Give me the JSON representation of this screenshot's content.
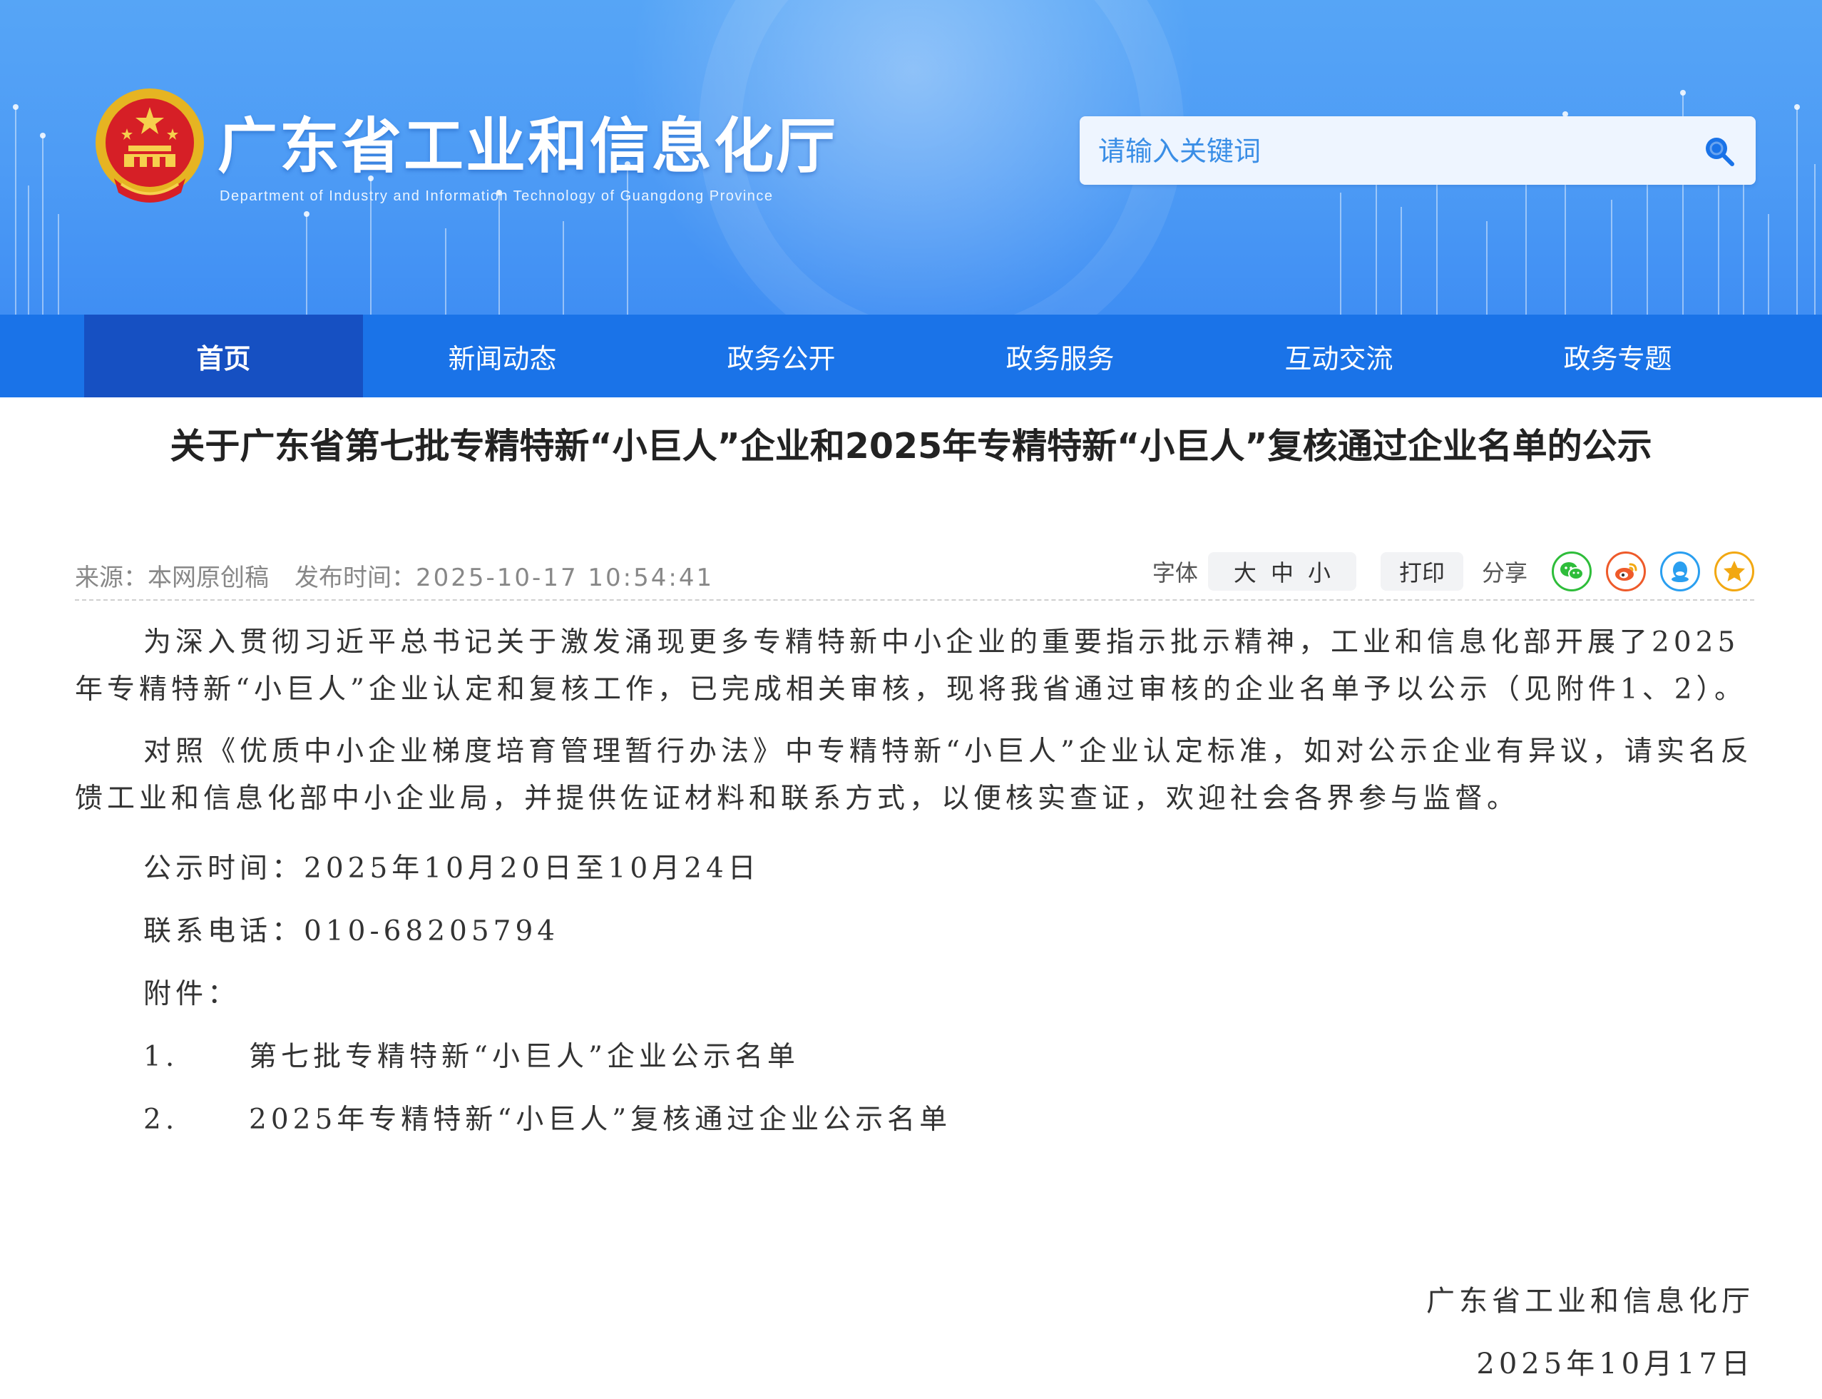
{
  "header": {
    "title": "广东省工业和信息化厅",
    "subtitle": "Department of Industry and Information Technology of Guangdong Province",
    "search_placeholder": "请输入关键词"
  },
  "nav": {
    "items": [
      {
        "label": "首页",
        "active": true
      },
      {
        "label": "新闻动态"
      },
      {
        "label": "政务公开"
      },
      {
        "label": "政务服务"
      },
      {
        "label": "互动交流"
      },
      {
        "label": "政务专题"
      }
    ]
  },
  "article": {
    "title": "关于广东省第七批专精特新“小巨人”企业和2025年专精特新“小巨人”复核通过企业名单的公示",
    "meta": {
      "source_label": "来源：",
      "source": "本网原创稿",
      "time_label": "发布时间：",
      "time": "2025-10-17 10:54:41"
    },
    "tools": {
      "font_label": "字体",
      "font_large": "大",
      "font_medium": "中",
      "font_small": "小",
      "print": "打印",
      "share_label": "分享"
    },
    "paragraphs": [
      "为深入贯彻习近平总书记关于激发涌现更多专精特新中小企业的重要指示批示精神，工业和信息化部开展了2025年专精特新“小巨人”企业认定和复核工作，已完成相关审核，现将我省通过审核的企业名单予以公示（见附件1、2）。",
      "对照《优质中小企业梯度培育管理暂行办法》中专精特新“小巨人”企业认定标准，如对公示企业有异议，请实名反馈工业和信息化部中小企业局，并提供佐证材料和联系方式，以便核实查证，欢迎社会各界参与监督。"
    ],
    "notice_time": "公示时间：2025年10月20日至10月24日",
    "contact": "联系电话：010-68205794",
    "attachments_label": "附件：",
    "attachments": [
      {
        "num": "1.",
        "name": "第七批专精特新“小巨人”企业公示名单"
      },
      {
        "num": "2.",
        "name": "2025年专精特新“小巨人”复核通过企业公示名单"
      }
    ],
    "signature_org": "广东省工业和信息化厅",
    "signature_date": "2025年10月17日"
  },
  "colors": {
    "banner": "#4d9bf5",
    "nav": "#1a73e8",
    "nav_active": "#1650c2"
  }
}
